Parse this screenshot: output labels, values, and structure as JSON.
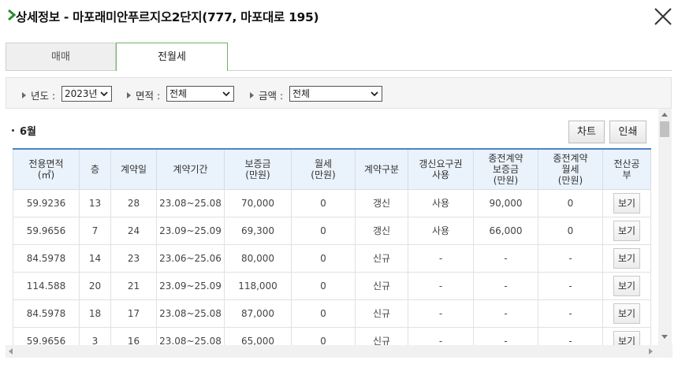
{
  "window": {
    "title": "상세정보 - 마포래미안푸르지오2단지(777, 마포대로 195)",
    "accent_color": "#2e8b2e"
  },
  "tabs": [
    {
      "label": "매매",
      "active": false
    },
    {
      "label": "전월세",
      "active": true
    }
  ],
  "filters": {
    "year_label": "년도 :",
    "year_value": "2023년",
    "area_label": "면적 :",
    "area_value": "전체",
    "amount_label": "금액 :",
    "amount_value": "전체"
  },
  "section": {
    "month": "6월",
    "chart_button": "차트",
    "print_button": "인쇄"
  },
  "table": {
    "headers": [
      [
        "전용면적",
        "(㎡)"
      ],
      [
        "층"
      ],
      [
        "계약일"
      ],
      [
        "계약기간"
      ],
      [
        "보증금",
        "(만원)"
      ],
      [
        "월세",
        "(만원)"
      ],
      [
        "계약구분"
      ],
      [
        "갱신요구권",
        "사용"
      ],
      [
        "종전계약",
        "보증금",
        "(만원)"
      ],
      [
        "종전계약",
        "월세",
        "(만원)"
      ],
      [
        "전산공",
        "부"
      ]
    ],
    "view_label": "보기",
    "rows": [
      [
        "59.9236",
        "13",
        "28",
        "23.08~25.08",
        "70,000",
        "0",
        "갱신",
        "사용",
        "90,000",
        "0"
      ],
      [
        "59.9656",
        "7",
        "24",
        "23.09~25.09",
        "69,300",
        "0",
        "갱신",
        "사용",
        "66,000",
        "0"
      ],
      [
        "84.5978",
        "14",
        "23",
        "23.06~25.06",
        "80,000",
        "0",
        "신규",
        "-",
        "-",
        "-"
      ],
      [
        "114.588",
        "20",
        "21",
        "23.09~25.09",
        "118,000",
        "0",
        "신규",
        "-",
        "-",
        "-"
      ],
      [
        "84.5978",
        "18",
        "17",
        "23.08~25.08",
        "87,000",
        "0",
        "신규",
        "-",
        "-",
        "-"
      ],
      [
        "59.9656",
        "3",
        "16",
        "23.08~25.08",
        "65,000",
        "0",
        "신규",
        "-",
        "-",
        "-"
      ]
    ]
  }
}
